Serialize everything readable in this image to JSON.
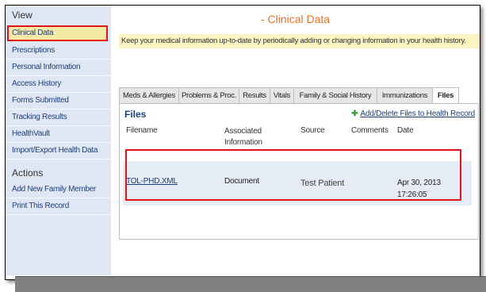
{
  "sidebar": {
    "view_label": "View",
    "items": [
      {
        "label": "Clinical Data",
        "active": true
      },
      {
        "label": "Prescriptions"
      },
      {
        "label": "Personal Information"
      },
      {
        "label": "Access History"
      },
      {
        "label": "Forms Submitted"
      },
      {
        "label": "Tracking Results"
      },
      {
        "label": "HealthVault"
      },
      {
        "label": "Import/Export Health Data"
      }
    ],
    "actions_label": "Actions",
    "actions": [
      {
        "label": "Add New Family Member"
      },
      {
        "label": "Print This Record"
      }
    ]
  },
  "main": {
    "title": "- Clinical Data",
    "info": "Keep your medical information up-to-date by periodically adding or changing information in your health history.",
    "tabs": [
      {
        "label": "Meds & Allergies"
      },
      {
        "label": "Problems & Proc."
      },
      {
        "label": "Results"
      },
      {
        "label": "Vitals"
      },
      {
        "label": "Family & Social History"
      },
      {
        "label": "Immunizations"
      },
      {
        "label": "Files",
        "active": true
      }
    ],
    "files": {
      "heading": "Files",
      "add_link": "Add/Delete Files to Health Record",
      "columns": [
        "Filename",
        "Associated Information",
        "Source",
        "Comments",
        "Date"
      ],
      "rows": [
        {
          "filename": "TOL-PHD.XML",
          "associated": "Document",
          "source": "Test Patient",
          "comments": "",
          "date": "Apr 30, 2013 17:26:05"
        }
      ]
    }
  },
  "colors": {
    "accent_title": "#e8742a",
    "highlight_red": "#e0121b",
    "sidebar_bg": "#dfe7f4",
    "info_bg": "#fbf3c2",
    "link_blue": "#1f3f7a"
  }
}
